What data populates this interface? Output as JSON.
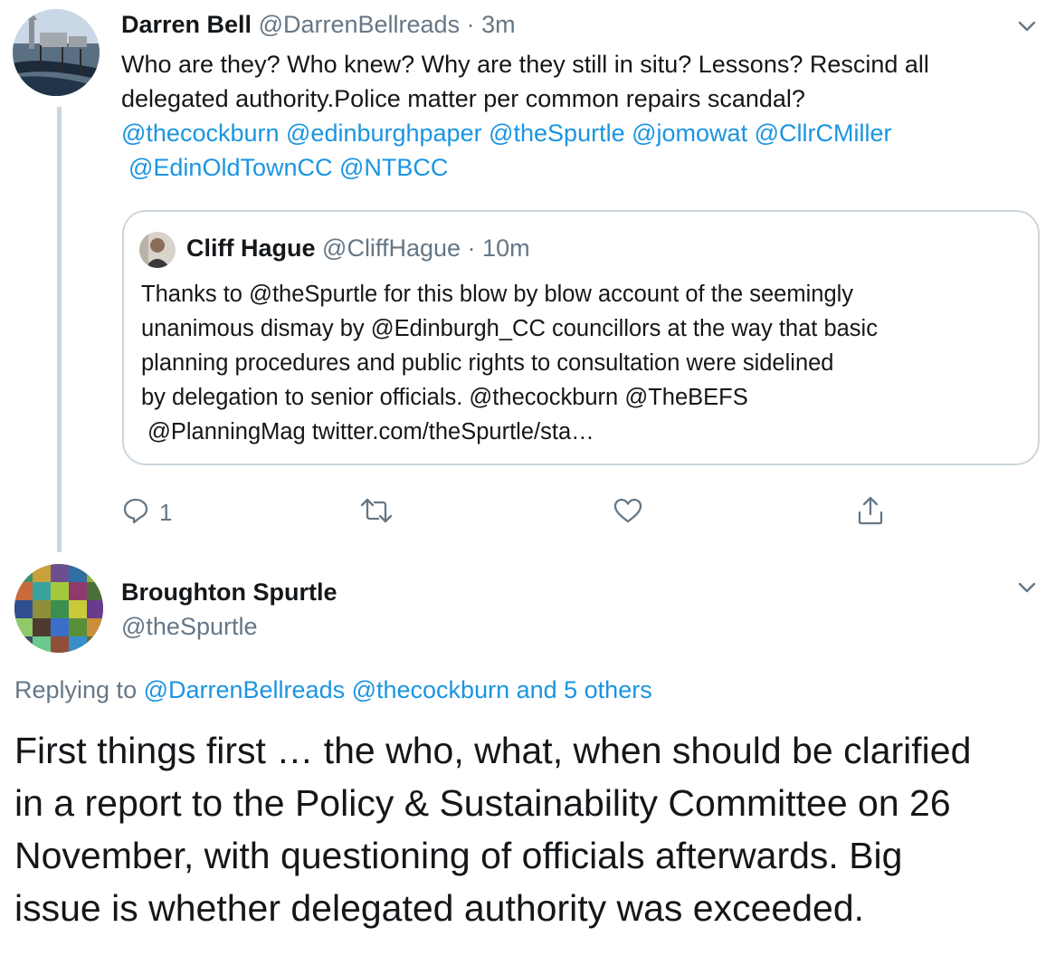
{
  "tweet1": {
    "name": "Darren Bell",
    "handle": "@DarrenBellreads",
    "sep": "·",
    "time": "3m",
    "text_lines": [
      "Who are they? Who knew? Why are they still in situ? Lessons? Rescind all",
      "delegated authority.Police matter per common repairs scandal?"
    ],
    "mentions_line1": [
      "@thecockburn",
      "@edinburghpaper",
      "@theSpurtle",
      "@jomowat",
      "@CllrCMiller"
    ],
    "mentions_line2": [
      "@EdinOldTownCC",
      "@NTBCC"
    ],
    "quote": {
      "name": "Cliff Hague",
      "handle": "@CliffHague",
      "sep": "·",
      "time": "10m",
      "line1_a": "Thanks to ",
      "line1_link": "@theSpurtle",
      "line1_b": " for this blow by blow account of the seemingly",
      "line2_a": "unanimous dismay by ",
      "line2_link": "@Edinburgh_CC",
      "line2_b": " councillors at the way that basic",
      "line3": "planning procedures and public rights to consultation were sidelined",
      "line4_a": "by delegation to senior officials. ",
      "line4_link1": "@thecockburn",
      "line4_sp": " ",
      "line4_link2": "@TheBEFS",
      "line5_link": "@PlanningMag",
      "line5_b": " twitter.com/theSpurtle/sta…"
    },
    "reply_count": "1"
  },
  "tweet2": {
    "name": "Broughton Spurtle",
    "handle": "@theSpurtle",
    "replying_prefix": "Replying to ",
    "replying_links": "@DarrenBellreads @thecockburn and 5 others",
    "text_lines": [
      "First things first … the who, what, when should be clarified",
      "in a report to the Policy & Sustainability Committee on 26",
      "November, with questioning of officials afterwards. Big",
      "issue is whether delegated authority was exceeded."
    ]
  },
  "icons": [
    "chevron-down-icon",
    "reply-icon",
    "retweet-icon",
    "like-icon",
    "share-icon"
  ],
  "colors": {
    "link": "#1b95e0",
    "muted": "#657786",
    "border": "#ccd6dd"
  }
}
